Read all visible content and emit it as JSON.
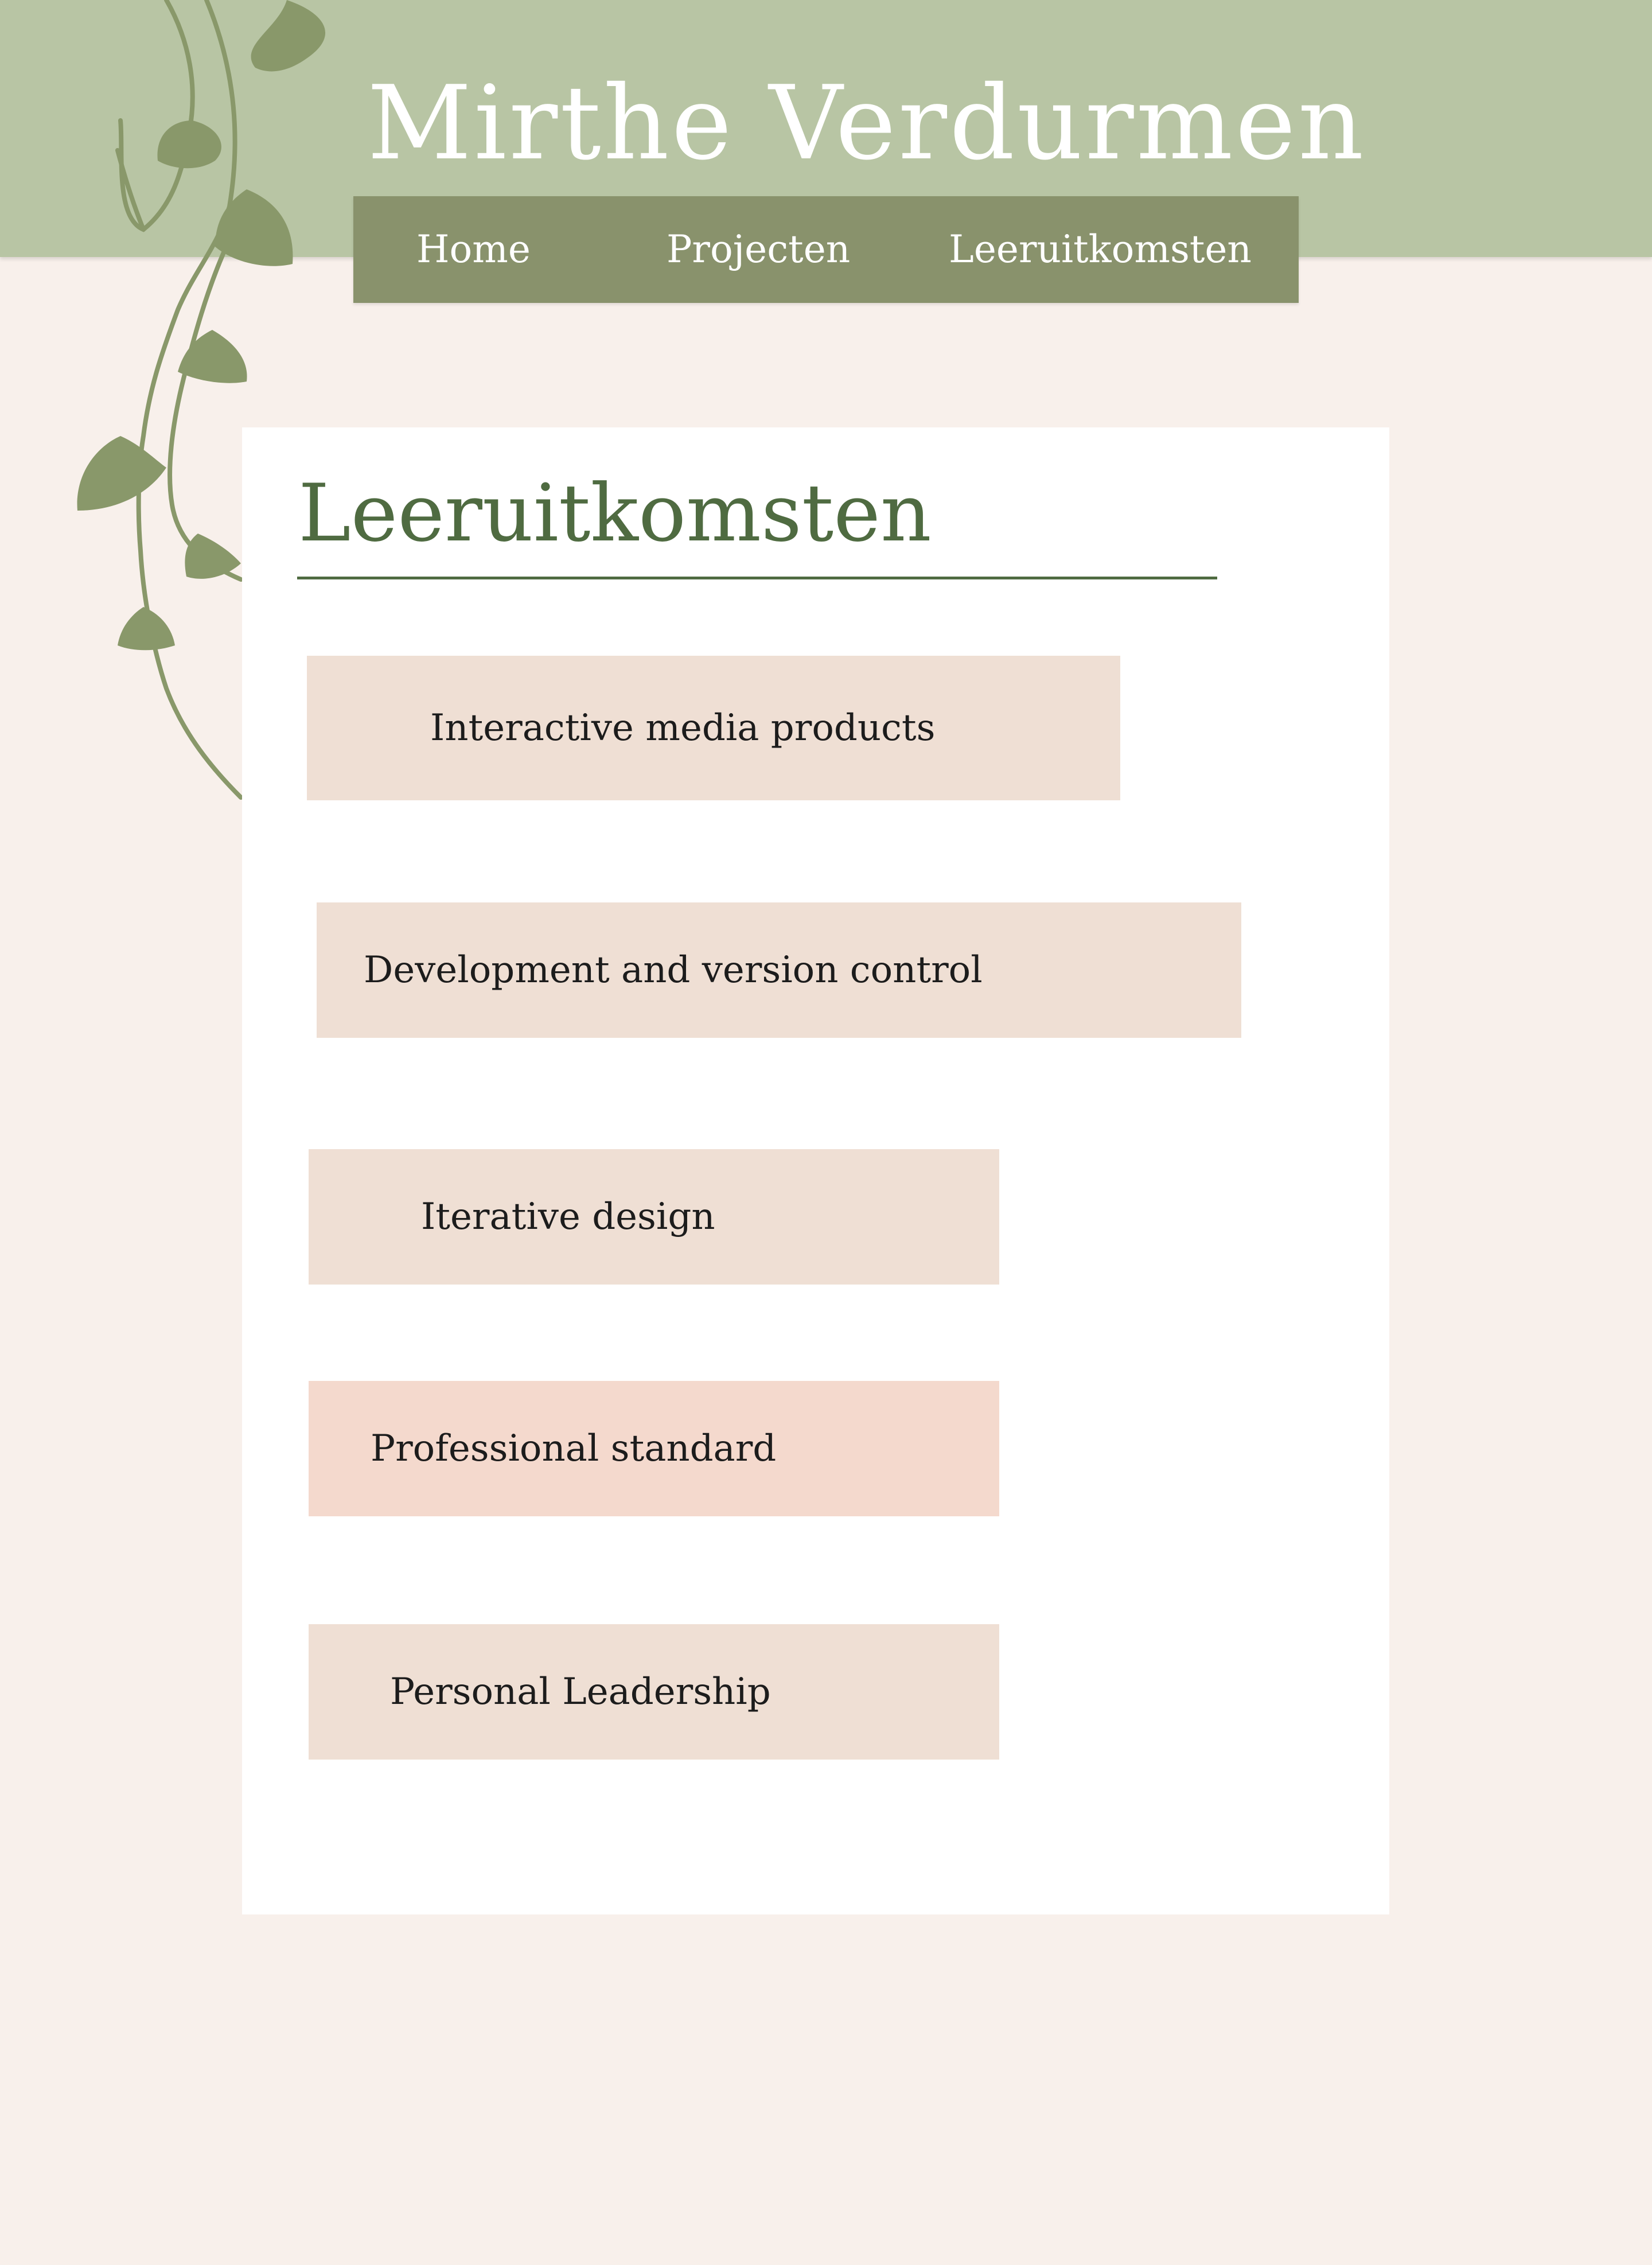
{
  "header": {
    "site_title": "Mirthe  Verdurmen",
    "bg_color": "#b8c5a4"
  },
  "nav": {
    "items": [
      {
        "label": "Home"
      },
      {
        "label": "Projecten"
      },
      {
        "label": "Leeruitkomsten"
      }
    ],
    "bg_color": "#89926c"
  },
  "main": {
    "title": "Leeruitkomsten",
    "title_color": "#4f6b41",
    "outcomes": [
      {
        "label": "Interactive media products"
      },
      {
        "label": "Development and version control"
      },
      {
        "label": "Iterative design"
      },
      {
        "label": "Professional standard"
      },
      {
        "label": "Personal Leadership"
      }
    ],
    "outcome_color": "#efdfd4",
    "outcome_alt_color": "#f4d9cd"
  },
  "page": {
    "bg_color": "#f8f0eb"
  },
  "decoration": {
    "icon": "vine-leaves-icon",
    "color": "#89986a"
  }
}
